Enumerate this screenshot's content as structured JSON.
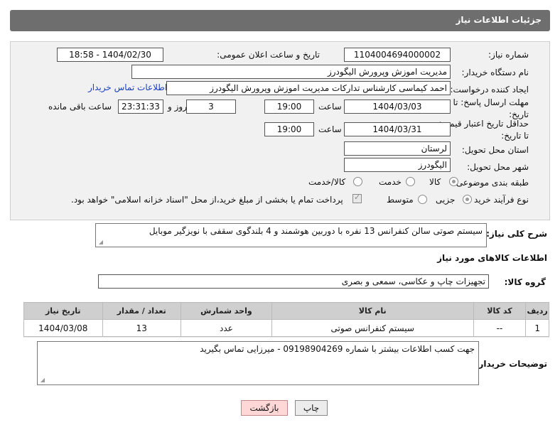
{
  "header": {
    "title": "جزئیات اطلاعات نیاز"
  },
  "form": {
    "need_number_label": "شماره نیاز:",
    "need_number": "1104004694000002",
    "announce_datetime_label": "تاریخ و ساعت اعلان عمومی:",
    "announce_datetime": "1404/02/30 - 18:58",
    "buyer_org_label": "نام دستگاه خریدار:",
    "buyer_org": "مدیریت اموزش وپرورش الیگودرز",
    "requester_label": "ایجاد کننده درخواست:",
    "requester": "احمد کیماسی کارشناس تدارکات مدیریت اموزش وپرورش الیگودرز",
    "buyer_contact_link": "اطلاعات تماس خریدار",
    "reply_deadline_label": "مهلت ارسال پاسخ: تا تاریخ:",
    "reply_date": "1404/03/03",
    "time_label": "ساعت",
    "reply_time": "19:00",
    "days_value": "3",
    "days_label": "روز و",
    "remaining_time": "23:31:33",
    "remaining_label": "ساعت باقی مانده",
    "price_validity_label": "حداقل تاریخ اعتبار قیمت: تا تاریخ:",
    "validity_date": "1404/03/31",
    "validity_time": "19:00",
    "province_label": "استان محل تحویل:",
    "province": "لرستان",
    "city_label": "شهر محل تحویل:",
    "city": "الیگودرز",
    "category_label": "طبقه بندی موضوعی:",
    "category_options": [
      "کالا",
      "خدمت",
      "کالا/خدمت"
    ],
    "category_selected": "کالا",
    "process_label": "نوع فرآیند خرید :",
    "process_options": [
      "جزیی",
      "متوسط"
    ],
    "process_selected": "جزیی",
    "payment_note": "پرداخت تمام یا بخشی از مبلغ خرید،از محل \"اسناد خزانه اسلامی\" خواهد بود."
  },
  "description": {
    "label": "شرح کلی نیاز:",
    "text": "سیستم صوتی سالن کنفرانس 13 نفره با دوربین هوشمند و 4 بلندگوی سقفی با نویزگیر موبایل"
  },
  "goods_info": {
    "section_title": "اطلاعات کالاهای مورد نیاز",
    "group_label": "گروه کالا:",
    "group_value": "تجهیزات چاپ و عکاسی، سمعی و بصری",
    "table": {
      "headers": [
        "ردیف",
        "کد کالا",
        "نام کالا",
        "واحد شمارش",
        "تعداد / مقدار",
        "تاریخ نیاز"
      ],
      "rows": [
        [
          "1",
          "--",
          "سیستم کنفرانس صوتی",
          "عدد",
          "13",
          "1404/03/08"
        ]
      ]
    }
  },
  "buyer_notes": {
    "label": "توضیحات خریدار:",
    "text": "جهت کسب اطلاعات بیشتر با شماره 09198904269 - میرزایی تماس بگیرید"
  },
  "buttons": {
    "print": "چاپ",
    "back": "بازگشت"
  },
  "colors": {
    "header_bg": "#6e6e6e",
    "panel_bg": "#f1f1f1",
    "link": "#1a3fbf",
    "back_button": "#ffd7d7"
  }
}
